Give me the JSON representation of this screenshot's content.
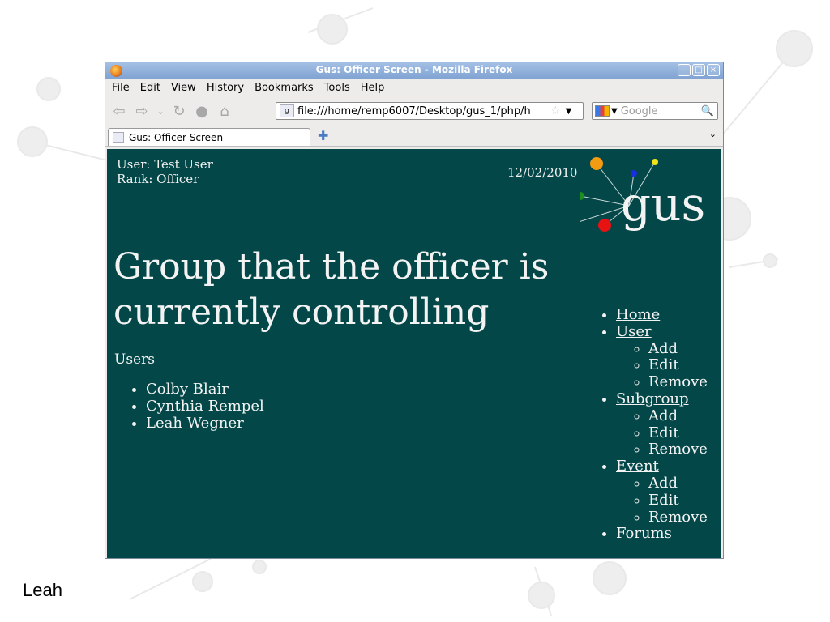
{
  "slide": {
    "caption": "Leah"
  },
  "window": {
    "title": "Gus: Officer Screen - Mozilla Firefox",
    "controls": [
      "minimize",
      "maximize",
      "close"
    ]
  },
  "menu": [
    "File",
    "Edit",
    "View",
    "History",
    "Bookmarks",
    "Tools",
    "Help"
  ],
  "navbar": {
    "url": "file:///home/remp6007/Desktop/gus_1/php/h",
    "search_placeholder": "Google"
  },
  "tabs": [
    {
      "label": "Gus: Officer Screen"
    }
  ],
  "page": {
    "user_line": "User: Test User",
    "rank_line": "Rank: Officer",
    "date": "12/02/2010",
    "logo_text": "gus",
    "headline": "Group that the officer is currently controlling",
    "users_label": "Users",
    "users": [
      "Colby Blair",
      "Cynthia Rempel",
      "Leah Wegner"
    ],
    "nav": {
      "home": "Home",
      "user": {
        "label": "User",
        "sub": [
          "Add",
          "Edit",
          "Remove"
        ]
      },
      "subgroup": {
        "label": "Subgroup",
        "sub": [
          "Add",
          "Edit",
          "Remove"
        ]
      },
      "event": {
        "label": "Event",
        "sub": [
          "Add",
          "Edit",
          "Remove"
        ]
      },
      "forums": "Forums"
    }
  },
  "colors": {
    "page_bg": "#034748",
    "page_text": "#f3f3f3",
    "titlebar": "#8aabd8"
  }
}
